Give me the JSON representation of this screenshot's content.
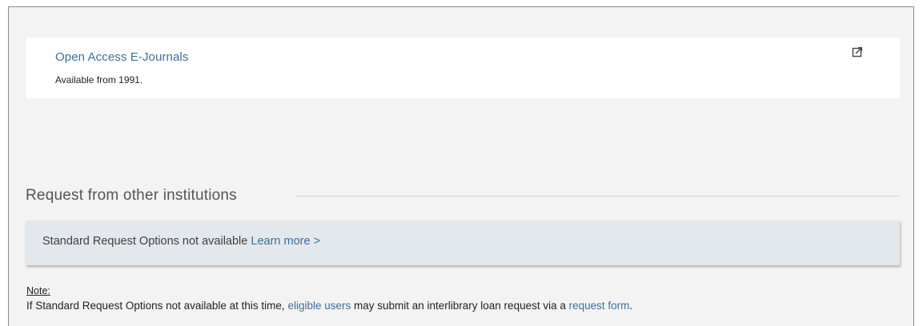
{
  "service": {
    "title": "Open Access E-Journals",
    "coverage": "Available from 1991.",
    "icon": "external-link-icon"
  },
  "request_section": {
    "title": "Request from other institutions",
    "status_text": "Standard Request Options not available",
    "learn_more": "Learn more",
    "chevron": ">"
  },
  "note": {
    "label": "Note:",
    "text_before": "If Standard Request Options not available at this time, ",
    "link1": "eligible users",
    "text_middle": " may submit an interlibrary loan request via a ",
    "link2": "request form",
    "text_after": "."
  },
  "colors": {
    "link": "#3d6e9e",
    "panel_background": "#f3f3f3",
    "request_box_background": "#e3e8ec"
  }
}
